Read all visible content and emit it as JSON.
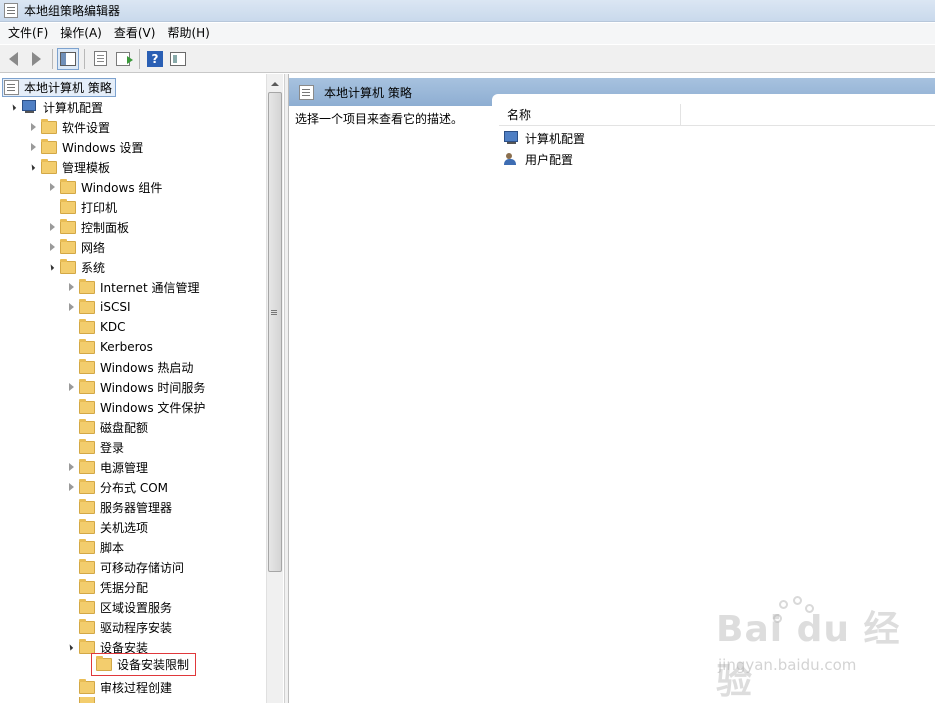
{
  "window": {
    "title": "本地组策略编辑器"
  },
  "menu": [
    {
      "label": "文件(F)"
    },
    {
      "label": "操作(A)"
    },
    {
      "label": "查看(V)"
    },
    {
      "label": "帮助(H)"
    }
  ],
  "toolbar": {
    "icons": [
      "back-icon",
      "forward-icon",
      "show-hide-tree-icon",
      "document-icon",
      "export-list-icon",
      "help-icon",
      "properties-icon"
    ],
    "help_glyph": "?"
  },
  "tree": {
    "root": "本地计算机 策略",
    "computer_config": "计算机配置",
    "software_settings": "软件设置",
    "windows_settings": "Windows 设置",
    "admin_templates": "管理模板",
    "windows_components": "Windows 组件",
    "printers": "打印机",
    "control_panel": "控制面板",
    "network": "网络",
    "system": "系统",
    "system_children": [
      "Internet 通信管理",
      "iSCSI",
      "KDC",
      "Kerberos",
      "Windows 热启动",
      "Windows 时间服务",
      "Windows 文件保护",
      "磁盘配额",
      "登录",
      "电源管理",
      "分布式 COM",
      "服务器管理器",
      "关机选项",
      "脚本",
      "可移动存储访问",
      "凭据分配",
      "区域设置服务",
      "驱动程序安装",
      "设备安装"
    ],
    "device_install_restrictions": "设备安装限制",
    "audit_process_creation": "审核过程创建"
  },
  "right_pane": {
    "header_title": "本地计算机 策略",
    "description": "选择一个项目来查看它的描述。",
    "column_name": "名称",
    "items": [
      "计算机配置",
      "用户配置"
    ]
  },
  "watermark": {
    "logo_text": "Bai  du 经验",
    "url": "jingyan.baidu.com"
  },
  "colors": {
    "header_blue": "#96b4d7",
    "highlight_red": "#e0383b",
    "folder_yellow": "#f3cd6d"
  }
}
